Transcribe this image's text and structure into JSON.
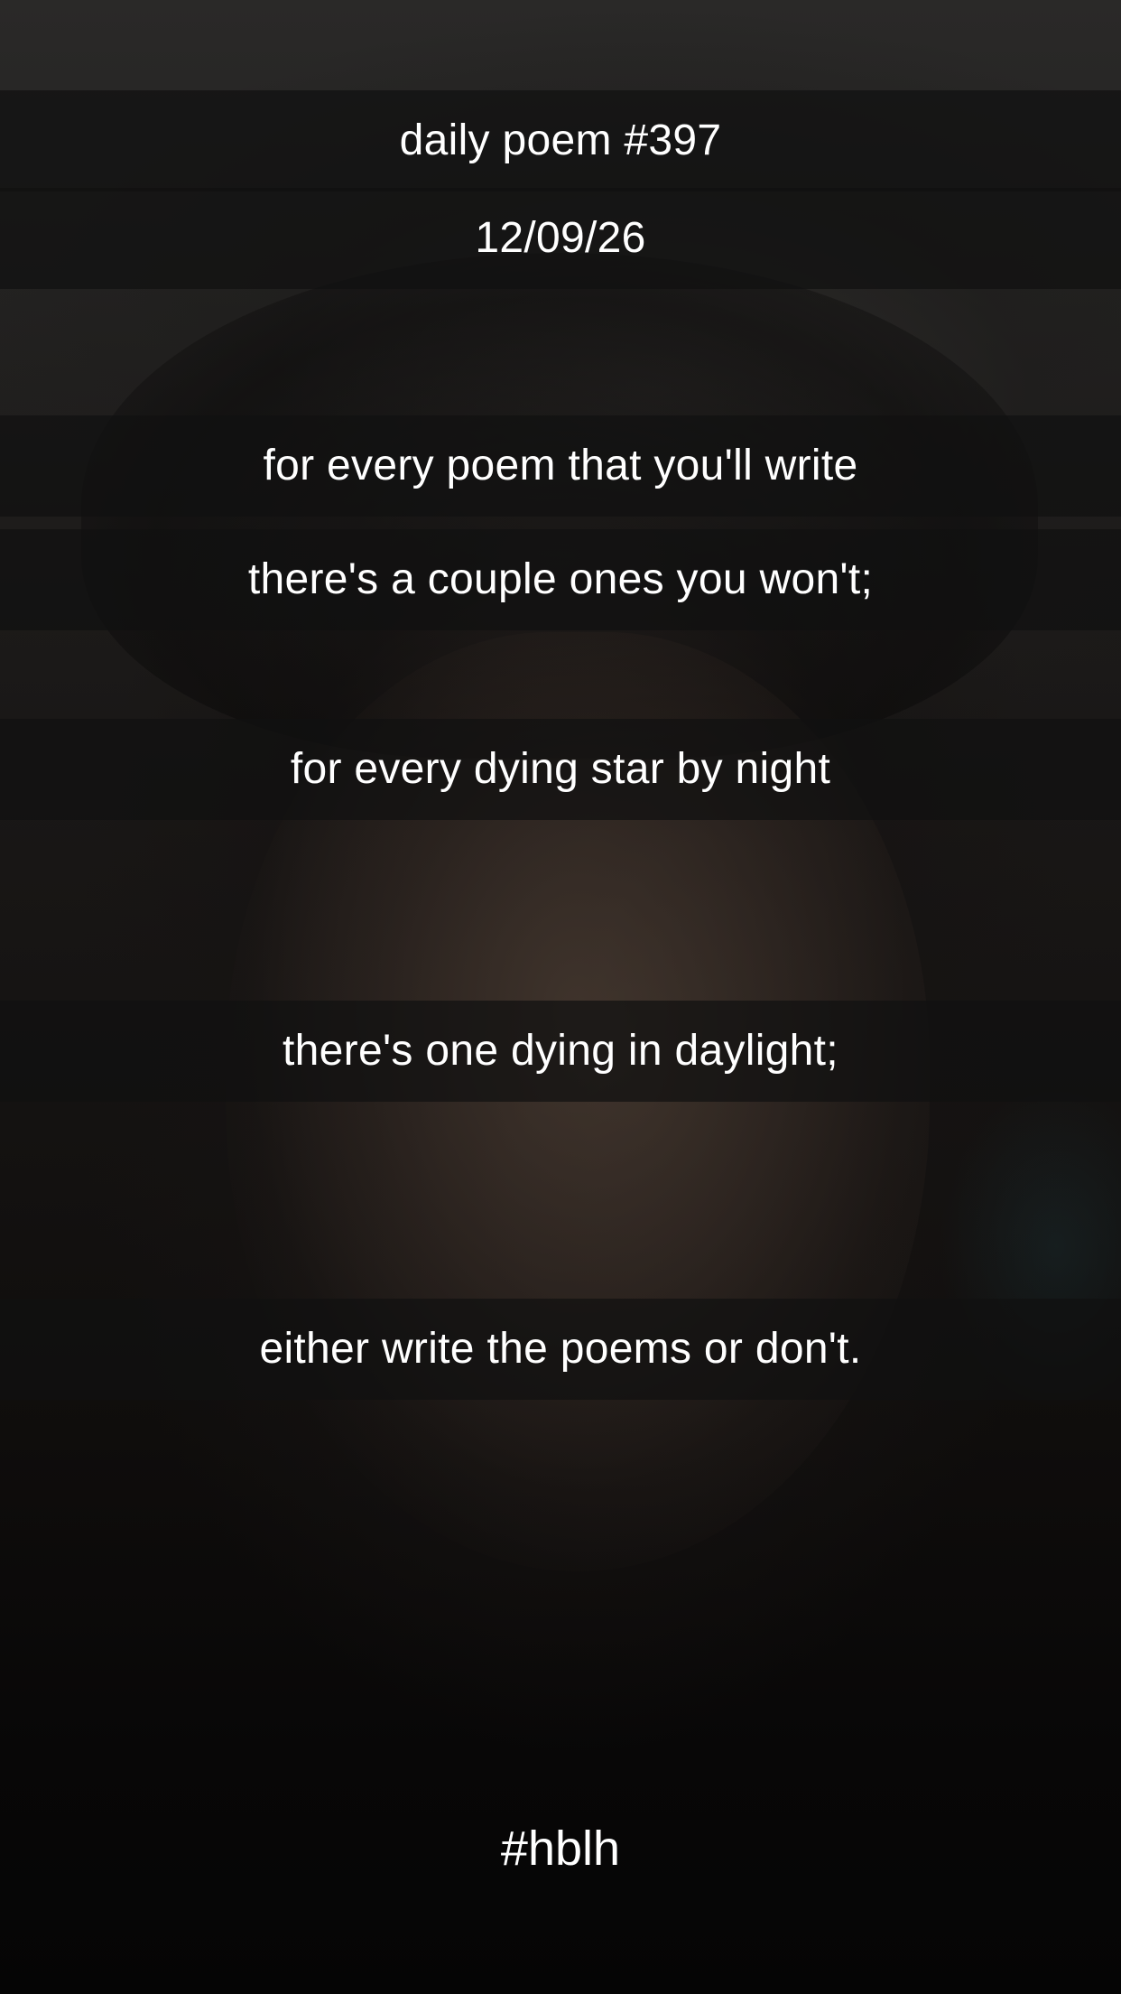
{
  "poem": {
    "title": "daily poem #397",
    "date": "12/09/26",
    "lines": [
      "for every poem that you'll write",
      "there's a couple ones you won't;",
      "for every dying star by night",
      "there's one dying in daylight;",
      "either write the poems or don't."
    ],
    "hashtag": "#hblh"
  },
  "colors": {
    "text": "#ffffff",
    "band": "#101010",
    "background": "#0c0b0b"
  }
}
